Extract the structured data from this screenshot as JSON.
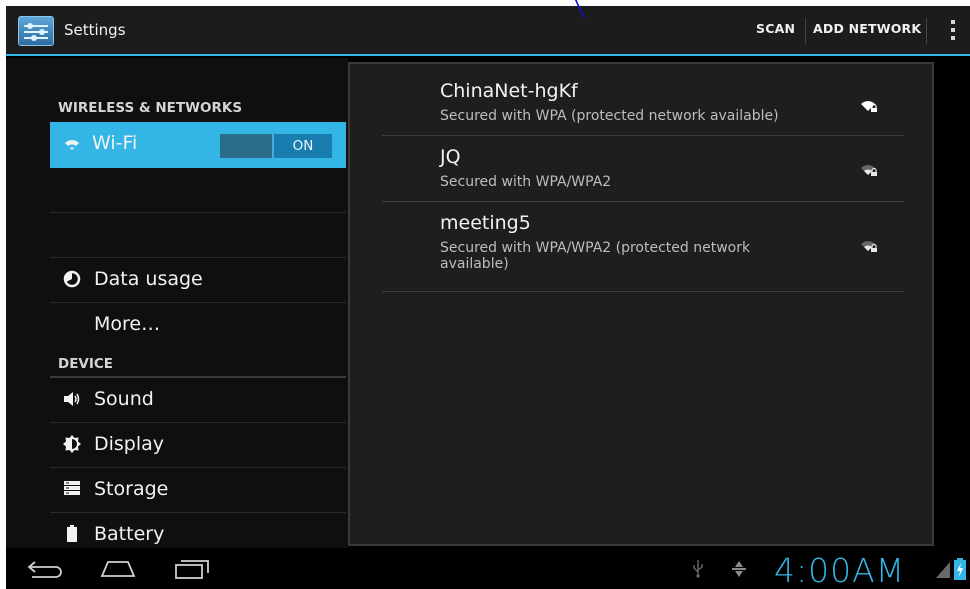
{
  "action_bar": {
    "title": "Settings",
    "scan_label": "SCAN",
    "add_network_label": "ADD NETWORK",
    "accent_color": "#33b5e5"
  },
  "sidebar": {
    "category_wireless": "WIRELESS & NETWORKS",
    "category_device": "DEVICE",
    "items": [
      {
        "label": "Wi-Fi",
        "icon": "wifi-icon",
        "selected": true
      },
      {
        "label": "Data usage",
        "icon": "data-usage-icon"
      },
      {
        "label": "More…",
        "icon": ""
      },
      {
        "label": "Sound",
        "icon": "speaker-icon"
      },
      {
        "label": "Display",
        "icon": "brightness-icon"
      },
      {
        "label": "Storage",
        "icon": "storage-icon"
      },
      {
        "label": "Battery",
        "icon": "battery-icon"
      }
    ],
    "wifi_toggle": "ON"
  },
  "networks": [
    {
      "ssid": "ChinaNet-hgKf",
      "security": "Secured with WPA (protected network available)",
      "signal": "strong"
    },
    {
      "ssid": "JQ",
      "security": "Secured with WPA/WPA2",
      "signal": "medium"
    },
    {
      "ssid": "meeting5",
      "security": "Secured with WPA/WPA2 (protected network available)",
      "signal": "medium"
    }
  ],
  "system_bar": {
    "time": "4:00AM"
  }
}
